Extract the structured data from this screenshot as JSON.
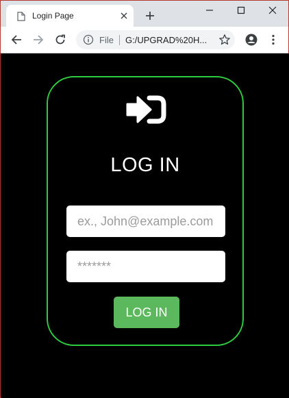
{
  "tab": {
    "title": "Login Page"
  },
  "toolbar": {
    "scheme_label": "File",
    "url": "G:/UPGRAD%20H..."
  },
  "login": {
    "title": "LOG IN",
    "email_placeholder": "ex., John@example.com",
    "password_placeholder": "*******",
    "submit_label": "LOG IN"
  },
  "colors": {
    "page_background": "#000000",
    "card_border": "#2ecc40",
    "button_background": "#5cb85c",
    "window_border": "#b5352f"
  },
  "icons": {
    "favicon": "page-icon",
    "tab_close": "close-icon",
    "new_tab": "plus-icon",
    "minimize": "minimize-icon",
    "maximize": "maximize-icon",
    "close_window": "close-icon",
    "back": "back-arrow-icon",
    "forward": "forward-arrow-icon",
    "reload": "reload-icon",
    "site_info": "info-icon",
    "bookmark": "star-icon",
    "profile": "account-icon",
    "menu": "kebab-menu-icon",
    "login": "sign-in-icon"
  }
}
